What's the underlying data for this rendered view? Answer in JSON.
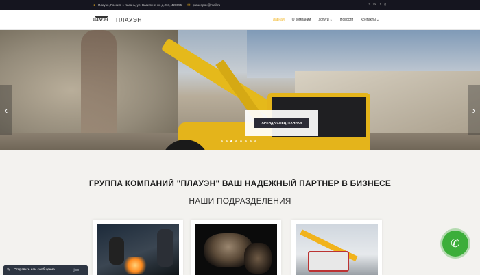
{
  "topbar": {
    "address": "Плаузн, Россия, г. Казань, ул. Васильченко д.267, 428055",
    "email": "plauenpok@mail.ru",
    "location_icon": "map-pin-icon",
    "mail_icon": "mail-icon",
    "social": [
      "facebook-icon",
      "vk-icon",
      "twitter-icon",
      "google-icon"
    ]
  },
  "nav": {
    "logo_text": "ПЛАУЭН",
    "brand": "ПЛАУЭН",
    "items": [
      {
        "label": "Главная",
        "caret": false
      },
      {
        "label": "О компании",
        "caret": false
      },
      {
        "label": "Услуги",
        "caret": true
      },
      {
        "label": "Новости",
        "caret": false
      },
      {
        "label": "Контакты",
        "caret": true
      }
    ]
  },
  "hero": {
    "cta_label": "АРЕНДА СПЕЦТЕХНИКИ",
    "slide_count": 8,
    "active_slide": 2
  },
  "content": {
    "headline": "ГРУППА КОМПАНИЙ \"ПЛАУЭН\" ВАШ НАДЕЖНЫЙ ПАРТНЕР В БИЗНЕСЕ",
    "subhead": "НАШИ ПОДРАЗДЕЛЕНИЯ"
  },
  "chat": {
    "label": "Отправьте нам сообщение",
    "brand": "jivo"
  },
  "colors": {
    "accent": "#f1b31c",
    "dark": "#15151f",
    "phone_green": "#3cae3a"
  }
}
